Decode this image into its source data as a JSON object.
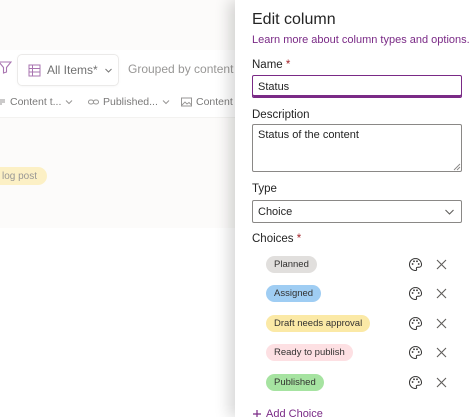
{
  "background": {
    "view": {
      "active_label": "All Items*",
      "grouped_label": "Grouped by content sta"
    },
    "columns": [
      {
        "label": "Content t...",
        "icon": "text-icon"
      },
      {
        "label": "Published...",
        "icon": "link-icon"
      },
      {
        "label": "Content i...",
        "icon": "image-icon"
      }
    ],
    "group_badge": "log post"
  },
  "panel": {
    "title": "Edit column",
    "learn_link": "Learn more about column types and options.",
    "name_label": "Name",
    "required_marker": "*",
    "name_value": "Status",
    "description_label": "Description",
    "description_value": "Status of the content",
    "type_label": "Type",
    "type_value": "Choice",
    "choices_label": "Choices",
    "choices": [
      {
        "label": "Planned",
        "color": "#e1dfdd"
      },
      {
        "label": "Assigned",
        "color": "#9fcdf3"
      },
      {
        "label": "Draft needs approval",
        "color": "#fbe9a6"
      },
      {
        "label": "Ready to publish",
        "color": "#fde0e3"
      },
      {
        "label": "Published",
        "color": "#a6e3a1"
      }
    ],
    "add_choice_label": "Add Choice"
  },
  "colors": {
    "accent": "#7a2a86",
    "required": "#a4262c"
  }
}
